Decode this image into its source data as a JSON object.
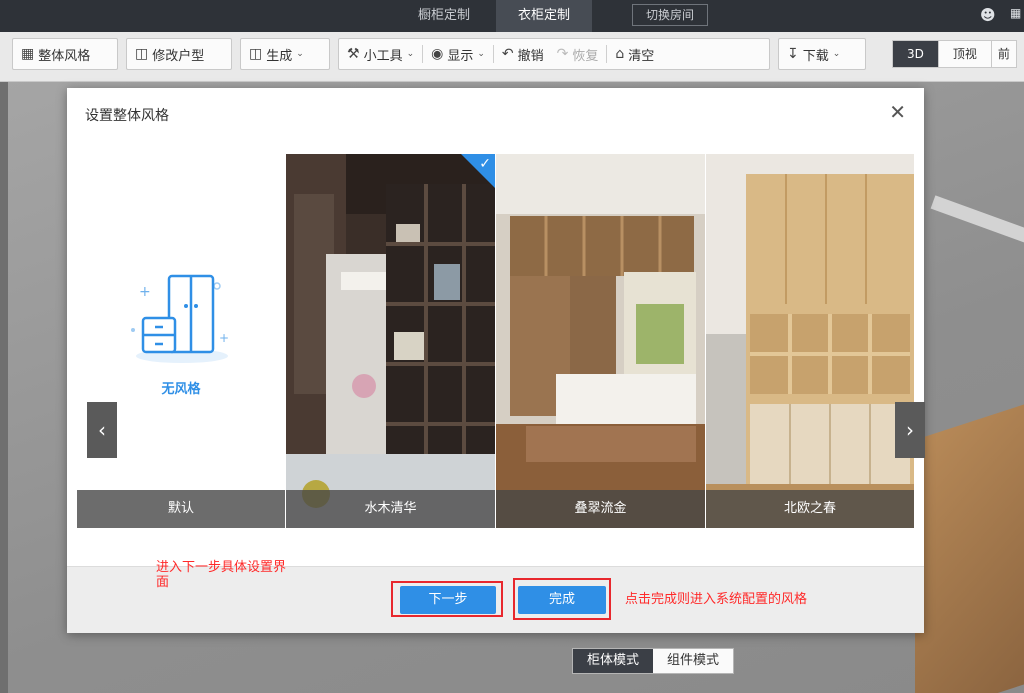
{
  "topbar": {
    "tabs": [
      "橱柜定制",
      "衣柜定制"
    ],
    "switch_room": "切换房间"
  },
  "toolbar": {
    "buttons": [
      "整体风格",
      "修改户型",
      "生成",
      "小工具",
      "显示",
      "撤销",
      "恢复",
      "清空",
      "下载"
    ],
    "views": [
      "3D",
      "顶视",
      "前"
    ]
  },
  "modal": {
    "title": "设置整体风格",
    "nostyle_label": "无风格",
    "cards": [
      "默认",
      "水木清华",
      "叠翠流金",
      "北欧之春"
    ],
    "next_button": "下一步",
    "finish_button": "完成",
    "note_next": "进入下一步具体设置界面",
    "note_finish": "点击完成则进入系统配置的风格"
  },
  "bottom": {
    "modes": [
      "柜体模式",
      "组件模式"
    ]
  },
  "colors": {
    "accent": "#2f8fe6",
    "annotation": "#e8272d"
  }
}
